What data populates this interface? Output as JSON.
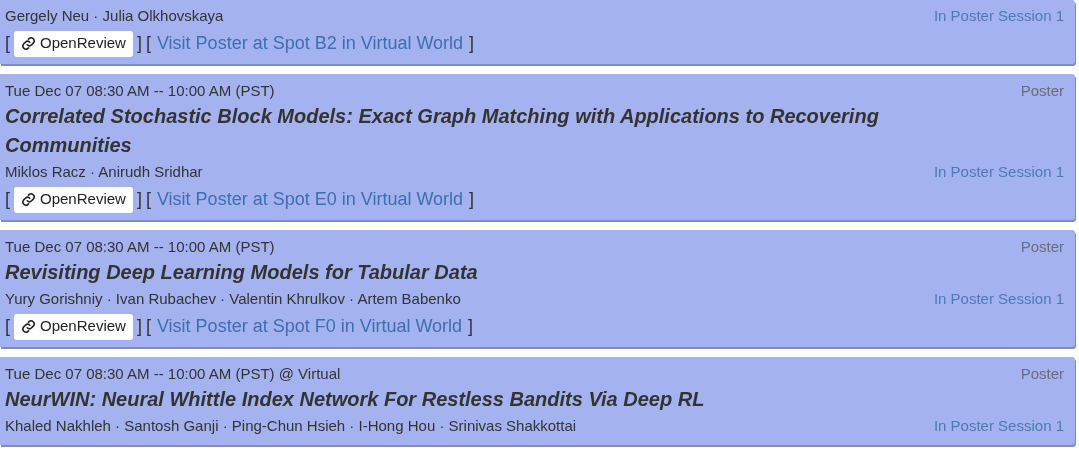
{
  "papers": [
    {
      "authors": "Gergely Neu · Julia Olkhovskaya",
      "session": "In Poster Session 1",
      "links": [
        {
          "kind": "openreview",
          "open": "[",
          "label": "OpenReview",
          "close": "]"
        },
        {
          "kind": "visit",
          "open": "[",
          "label": "Visit Poster at Spot B2 in Virtual World",
          "close": "]"
        }
      ]
    },
    {
      "time": "Tue Dec 07 08:30 AM -- 10:00 AM (PST)",
      "type": "Poster",
      "title": "Correlated Stochastic Block Models: Exact Graph Matching with Applications to Recovering Communities",
      "authors": "Miklos Racz · Anirudh Sridhar",
      "session": "In Poster Session 1",
      "links": [
        {
          "kind": "openreview",
          "open": "[",
          "label": "OpenReview",
          "close": "]"
        },
        {
          "kind": "visit",
          "open": "[",
          "label": "Visit Poster at Spot E0 in Virtual World",
          "close": "]"
        }
      ]
    },
    {
      "time": "Tue Dec 07 08:30 AM -- 10:00 AM (PST)",
      "type": "Poster",
      "title": "Revisiting Deep Learning Models for Tabular Data",
      "authors": "Yury Gorishniy · Ivan Rubachev · Valentin Khrulkov · Artem Babenko",
      "session": "In Poster Session 1",
      "links": [
        {
          "kind": "openreview",
          "open": "[",
          "label": "OpenReview",
          "close": "]"
        },
        {
          "kind": "visit",
          "open": "[",
          "label": "Visit Poster at Spot F0 in Virtual World",
          "close": "]"
        }
      ]
    },
    {
      "time": "Tue Dec 07 08:30 AM -- 10:00 AM (PST) @ Virtual",
      "type": "Poster",
      "title": "NeurWIN: Neural Whittle Index Network For Restless Bandits Via Deep RL",
      "authors": "Khaled Nakhleh · Santosh Ganji · Ping-Chun Hsieh · I-Hong Hou · Srinivas Shakkottai",
      "session": "In Poster Session 1"
    }
  ]
}
